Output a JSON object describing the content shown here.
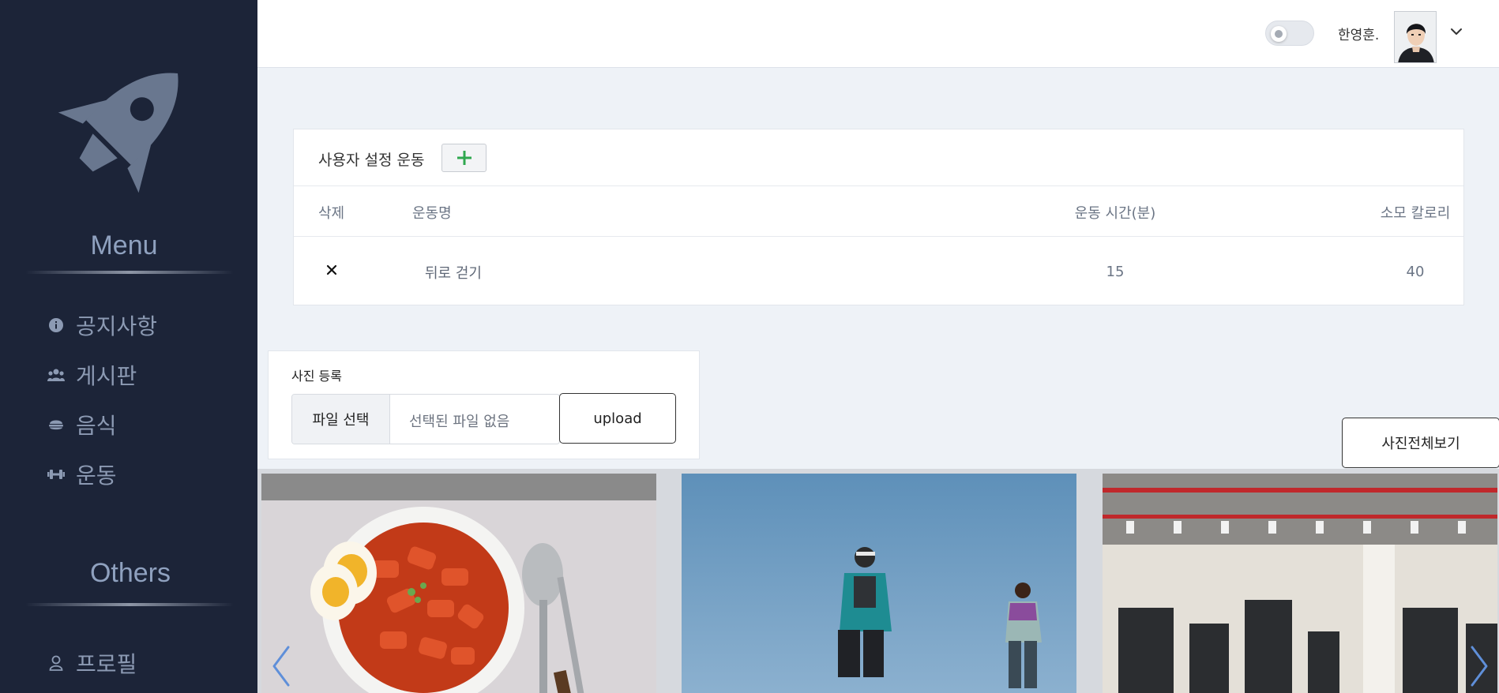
{
  "sidebar": {
    "menu_title": "Menu",
    "others_title": "Others",
    "logo_icon": "rocket-icon",
    "items": [
      {
        "label": "공지사항",
        "icon": "info-circle-icon"
      },
      {
        "label": "게시판",
        "icon": "users-icon"
      },
      {
        "label": "음식",
        "icon": "burger-icon"
      },
      {
        "label": "운동",
        "icon": "dumbbell-icon"
      },
      {
        "label": "프로필",
        "icon": "user-icon"
      }
    ]
  },
  "header": {
    "user_name": "한영훈.",
    "toggle_on": false
  },
  "exercise": {
    "title": "사용자 설정 운동",
    "add_icon": "plus-icon",
    "columns": [
      "삭제",
      "운동명",
      "운동 시간(분)",
      "소모 칼로리"
    ],
    "rows": [
      {
        "name": "뒤로 걷기",
        "time": "15",
        "calories": "40"
      }
    ]
  },
  "photo_upload": {
    "title": "사진 등록",
    "file_button": "파일 선택",
    "file_status": "선택된 파일 없음",
    "upload_button": "upload"
  },
  "view_all_button": "사진전체보기",
  "gallery": {
    "photos": [
      "tteokbokki-photo",
      "runners-photo",
      "gym-photo"
    ]
  },
  "colors": {
    "sidebar_bg": "#1c2438",
    "sidebar_text": "#8c9ab3",
    "page_bg": "#eef2f7",
    "accent_green": "#2fa84f"
  }
}
